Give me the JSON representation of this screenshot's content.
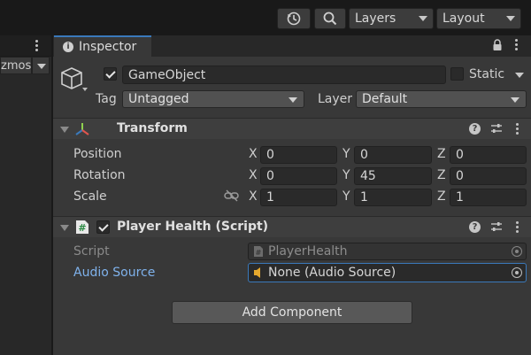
{
  "toolbar": {
    "layers_label": "Layers",
    "layout_label": "Layout"
  },
  "left_panel": {
    "gizmos_label": "zmos"
  },
  "inspector": {
    "tab_label": "Inspector",
    "gameobject": {
      "active": true,
      "name": "GameObject",
      "static_label": "Static",
      "static_checked": false,
      "tag_label": "Tag",
      "tag_value": "Untagged",
      "layer_label": "Layer",
      "layer_value": "Default"
    },
    "transform": {
      "title": "Transform",
      "position_label": "Position",
      "rotation_label": "Rotation",
      "scale_label": "Scale",
      "axis_x": "X",
      "axis_y": "Y",
      "axis_z": "Z",
      "position": {
        "x": "0",
        "y": "0",
        "z": "0"
      },
      "rotation": {
        "x": "0",
        "y": "45",
        "z": "0"
      },
      "scale": {
        "x": "1",
        "y": "1",
        "z": "1"
      }
    },
    "player_health": {
      "title": "Player Health (Script)",
      "enabled": true,
      "script_label": "Script",
      "script_value": "PlayerHealth",
      "audio_source_label": "Audio Source",
      "audio_source_value": "None (Audio Source)"
    },
    "add_component_label": "Add Component"
  },
  "colors": {
    "accent_blue": "#3a79bb",
    "link_label": "#7fb2ec",
    "panel_bg": "#383838"
  }
}
